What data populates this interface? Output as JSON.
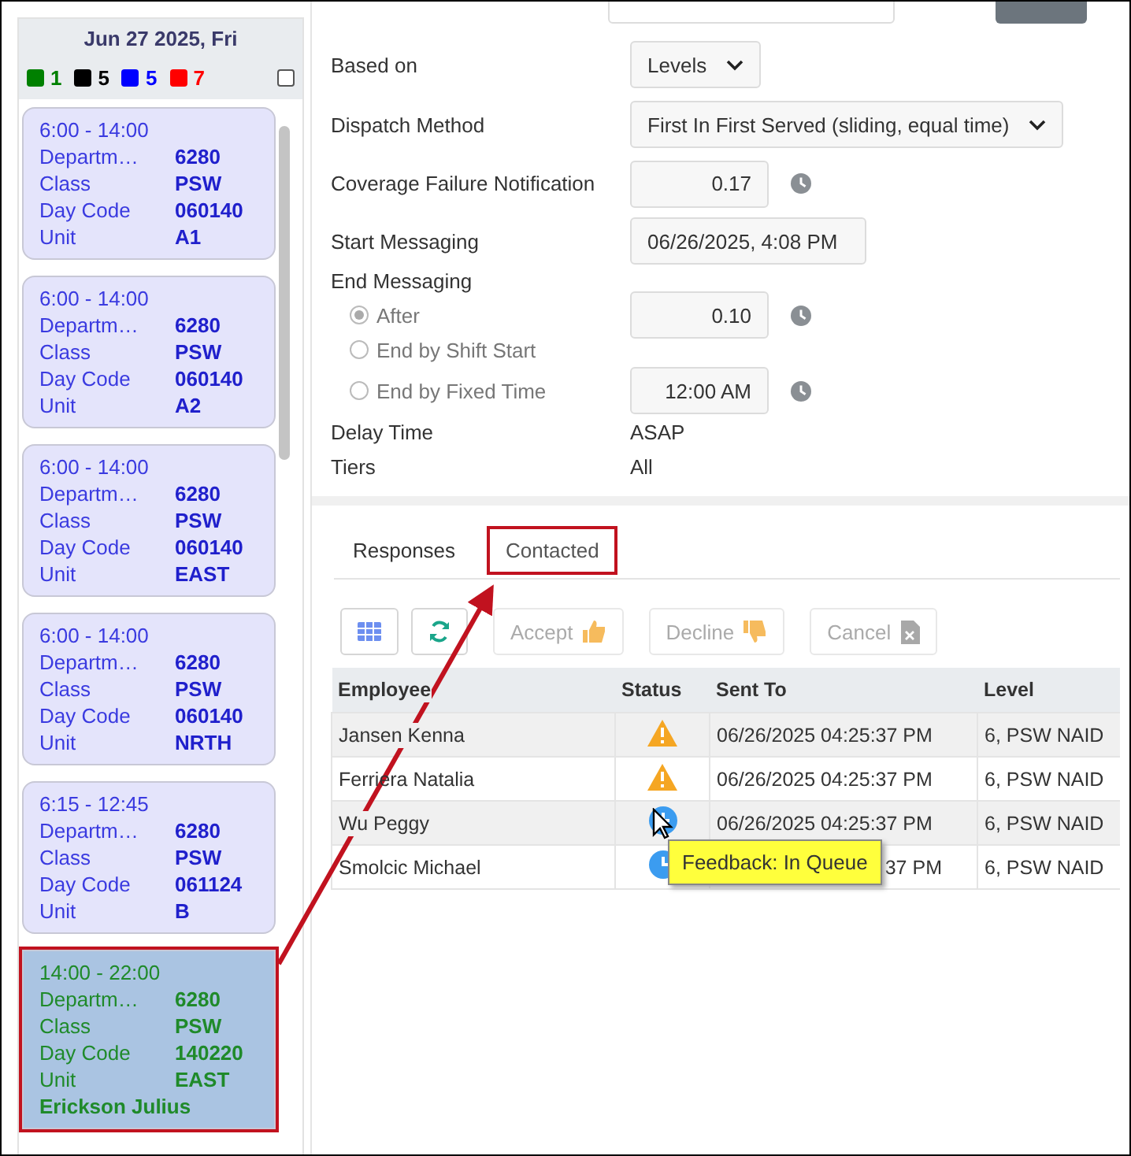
{
  "date_header": "Jun 27 2025, Fri",
  "legend": [
    {
      "color": "#008000",
      "count": "1"
    },
    {
      "color": "#000000",
      "count": "5"
    },
    {
      "color": "#0000ff",
      "count": "5"
    },
    {
      "color": "#ff0000",
      "count": "7"
    }
  ],
  "legend_checkbox": {
    "checked": false
  },
  "shifts": [
    {
      "time": "6:00 - 14:00",
      "fields": [
        {
          "label": "Departm…",
          "value": "6280"
        },
        {
          "label": "Class",
          "value": "PSW"
        },
        {
          "label": "Day Code",
          "value": "060140"
        },
        {
          "label": "Unit",
          "value": "A1"
        }
      ],
      "selected": false,
      "highlighted": false
    },
    {
      "time": "6:00 - 14:00",
      "fields": [
        {
          "label": "Departm…",
          "value": "6280"
        },
        {
          "label": "Class",
          "value": "PSW"
        },
        {
          "label": "Day Code",
          "value": "060140"
        },
        {
          "label": "Unit",
          "value": "A2"
        }
      ],
      "selected": false,
      "highlighted": false
    },
    {
      "time": "6:00 - 14:00",
      "fields": [
        {
          "label": "Departm…",
          "value": "6280"
        },
        {
          "label": "Class",
          "value": "PSW"
        },
        {
          "label": "Day Code",
          "value": "060140"
        },
        {
          "label": "Unit",
          "value": "EAST"
        }
      ],
      "selected": false,
      "highlighted": false
    },
    {
      "time": "6:00 - 14:00",
      "fields": [
        {
          "label": "Departm…",
          "value": "6280"
        },
        {
          "label": "Class",
          "value": "PSW"
        },
        {
          "label": "Day Code",
          "value": "060140"
        },
        {
          "label": "Unit",
          "value": "NRTH"
        }
      ],
      "selected": false,
      "highlighted": false
    },
    {
      "time": "6:15 - 12:45",
      "fields": [
        {
          "label": "Departm…",
          "value": "6280"
        },
        {
          "label": "Class",
          "value": "PSW"
        },
        {
          "label": "Day Code",
          "value": "061124"
        },
        {
          "label": "Unit",
          "value": "B"
        }
      ],
      "selected": false,
      "highlighted": false
    },
    {
      "time": "14:00 - 22:00",
      "fields": [
        {
          "label": "Departm…",
          "value": "6280"
        },
        {
          "label": "Class",
          "value": "PSW"
        },
        {
          "label": "Day Code",
          "value": "140220"
        },
        {
          "label": "Unit",
          "value": "EAST"
        }
      ],
      "employee": "Erickson Julius",
      "selected": true,
      "highlighted": true
    }
  ],
  "form": [
    {
      "kind": "select",
      "label": "Based on",
      "value": "Levels"
    },
    {
      "kind": "select",
      "label": "Dispatch Method",
      "value": "First In First Served (sliding, equal time)"
    },
    {
      "kind": "number",
      "label": "Coverage Failure Notification",
      "value": "0.17"
    },
    {
      "kind": "date",
      "label": "Start Messaging",
      "value": "06/26/2025, 4:08 PM"
    },
    {
      "kind": "heading",
      "label": "End Messaging"
    },
    {
      "kind": "radio",
      "label": "After",
      "selected": true,
      "value": "0.10"
    },
    {
      "kind": "radio",
      "label": "End by Shift Start",
      "selected": false
    },
    {
      "kind": "radio",
      "label": "End by Fixed Time",
      "selected": false,
      "value": "12:00 AM"
    },
    {
      "kind": "text",
      "label": "Delay Time",
      "value": "ASAP"
    },
    {
      "kind": "text",
      "label": "Tiers",
      "value": "All"
    }
  ],
  "tabs": [
    {
      "label": "Responses",
      "selected": false,
      "highlighted": false
    },
    {
      "label": "Contacted",
      "selected": true,
      "highlighted": true
    }
  ],
  "toolbar": [
    {
      "kind": "grid",
      "disabled": false
    },
    {
      "kind": "refresh",
      "disabled": false
    },
    {
      "kind": "accept",
      "label": "Accept",
      "disabled": true
    },
    {
      "kind": "decline",
      "label": "Decline",
      "disabled": true
    },
    {
      "kind": "cancel",
      "label": "Cancel",
      "disabled": true
    }
  ],
  "table": {
    "columns": [
      "Employee",
      "Status",
      "Sent To",
      "Level"
    ],
    "rows": [
      {
        "employee": "Jansen Kenna",
        "kind": "warning",
        "sent_to": "06/26/2025 04:25:37 PM",
        "covered": false,
        "level": "6, PSW NAID"
      },
      {
        "employee": "Ferriera Natalia",
        "kind": "warning",
        "sent_to": "06/26/2025 04:25:37 PM",
        "covered": false,
        "level": "6, PSW NAID"
      },
      {
        "employee": "Wu Peggy",
        "kind": "queued",
        "sent_to": "06/26/2025 04:25:37 PM",
        "covered": false,
        "level": "6, PSW NAID"
      },
      {
        "employee": "Smolcic Michael",
        "kind": "queued",
        "sent_to": "37 PM",
        "covered": true,
        "level": "6, PSW NAID"
      }
    ]
  },
  "tooltip": "Feedback: In Queue",
  "callout_arrow": true
}
